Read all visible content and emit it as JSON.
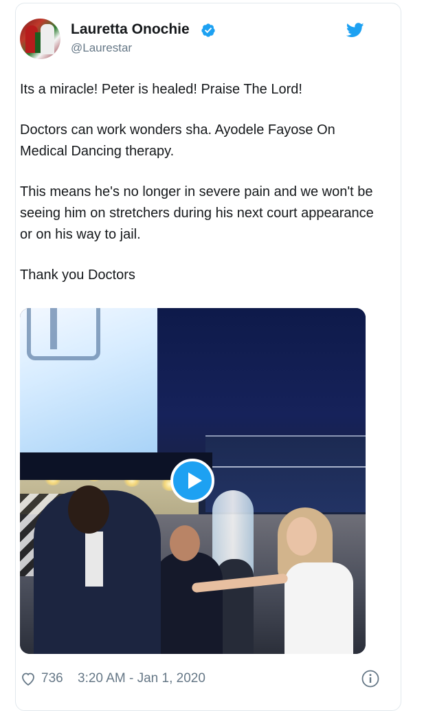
{
  "tweet": {
    "author": {
      "name": "Lauretta Onochie",
      "handle": "@Laurestar",
      "verified": true
    },
    "paragraphs": [
      "Its a miracle! Peter is healed! Praise The Lord!",
      "Doctors can work wonders sha. Ayodele Fayose On Medical Dancing therapy.",
      "This means he's no longer in severe pain and we won't be seeing him on stretchers during his next court appearance or on his way to jail.",
      "Thank you Doctors"
    ],
    "media": {
      "type": "video"
    },
    "footer": {
      "likes": "736",
      "timestamp": "3:20 AM - Jan 1, 2020"
    }
  },
  "colors": {
    "accent": "#1da1f2",
    "text": "#14171a",
    "secondary": "#657786",
    "border": "#e1e8ed"
  },
  "icons": [
    "verified-badge-icon",
    "twitter-bird-icon",
    "play-icon",
    "heart-icon",
    "info-icon"
  ]
}
